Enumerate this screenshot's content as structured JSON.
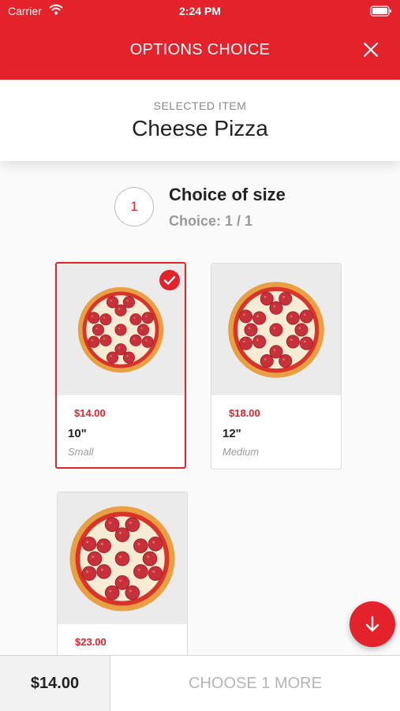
{
  "status_bar": {
    "carrier": "Carrier",
    "time": "2:24 PM"
  },
  "header": {
    "title": "OPTIONS CHOICE"
  },
  "selected_item": {
    "caption": "SELECTED ITEM",
    "name": "Cheese Pizza"
  },
  "step": {
    "number": "1",
    "title": "Choice of size",
    "subtitle": "Choice: 1 / 1"
  },
  "options": [
    {
      "price": "$14.00",
      "size": "10\"",
      "description": "Small",
      "selected": true
    },
    {
      "price": "$18.00",
      "size": "12\"",
      "description": "Medium",
      "selected": false
    },
    {
      "price": "$23.00",
      "size": "",
      "description": "",
      "selected": false
    }
  ],
  "footer": {
    "total": "$14.00",
    "action": "CHOOSE 1 MORE"
  },
  "colors": {
    "accent": "#e3222b",
    "muted_text": "#9a9a9a",
    "card_image_bg": "#ebebeb"
  },
  "icons": {
    "close": "close-icon",
    "check": "check-circle-icon",
    "scroll_down": "arrow-down-icon",
    "wifi": "wifi-icon",
    "battery": "battery-icon",
    "pizza": "pizza-image"
  }
}
